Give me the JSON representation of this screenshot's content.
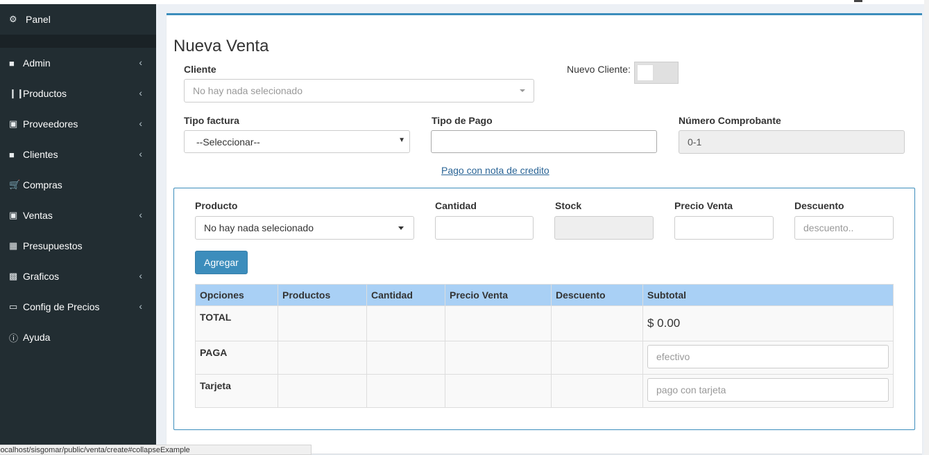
{
  "sidebar": {
    "panel_label": "Panel",
    "items": [
      {
        "label": "Admin",
        "icon": "folder-icon",
        "has_chevron": true
      },
      {
        "label": "Productos",
        "icon": "barcode-icon",
        "has_chevron": true
      },
      {
        "label": "Proveedores",
        "icon": "truck-icon",
        "has_chevron": true
      },
      {
        "label": "Clientes",
        "icon": "folder-icon",
        "has_chevron": true
      },
      {
        "label": "Compras",
        "icon": "shopping-cart-icon",
        "has_chevron": false
      },
      {
        "label": "Ventas",
        "icon": "money-icon",
        "has_chevron": true
      },
      {
        "label": "Presupuestos",
        "icon": "calculator-icon",
        "has_chevron": false
      },
      {
        "label": "Graficos",
        "icon": "bar-chart-icon",
        "has_chevron": true
      },
      {
        "label": "Config de Precios",
        "icon": "laptop-icon",
        "has_chevron": true
      },
      {
        "label": "Ayuda",
        "icon": "info-circle-icon",
        "has_chevron": false
      }
    ]
  },
  "main": {
    "title": "Nueva Venta",
    "cliente": {
      "label": "Cliente",
      "placeholder": "No hay nada selecionado"
    },
    "nuevo_cliente": {
      "label": "Nuevo Cliente:",
      "checked": false
    },
    "tipo_factura": {
      "label": "Tipo factura",
      "value": "--Seleccionar--"
    },
    "tipo_pago": {
      "label": "Tipo de Pago",
      "value": ""
    },
    "numero_comprobante": {
      "label": "Número Comprobante",
      "value": "0-1"
    },
    "nota_credito_link": "Pago con nota de credito"
  },
  "detalle": {
    "producto": {
      "label": "Producto",
      "value": "No hay nada selecionado"
    },
    "cantidad": {
      "label": "Cantidad",
      "value": ""
    },
    "stock": {
      "label": "Stock",
      "value": ""
    },
    "precio_venta": {
      "label": "Precio Venta",
      "value": ""
    },
    "descuento": {
      "label": "Descuento",
      "placeholder": "descuento.."
    },
    "agregar_label": "Agregar",
    "table": {
      "headers": [
        "Opciones",
        "Productos",
        "Cantidad",
        "Precio Venta",
        "Descuento",
        "Subtotal"
      ],
      "total_label": "TOTAL",
      "total_value": "$ 0.00",
      "paga_label": "PAGA",
      "paga_placeholder": "efectivo",
      "tarjeta_label": "Tarjeta",
      "tarjeta_placeholder": "pago con tarjeta"
    }
  },
  "statusbar": {
    "url": "localhost/sisgomar/public/venta/create#collapseExample"
  },
  "colors": {
    "sidebar_bg": "#222d32",
    "accent": "#3c8dbc",
    "table_header": "#a9d0f5"
  }
}
